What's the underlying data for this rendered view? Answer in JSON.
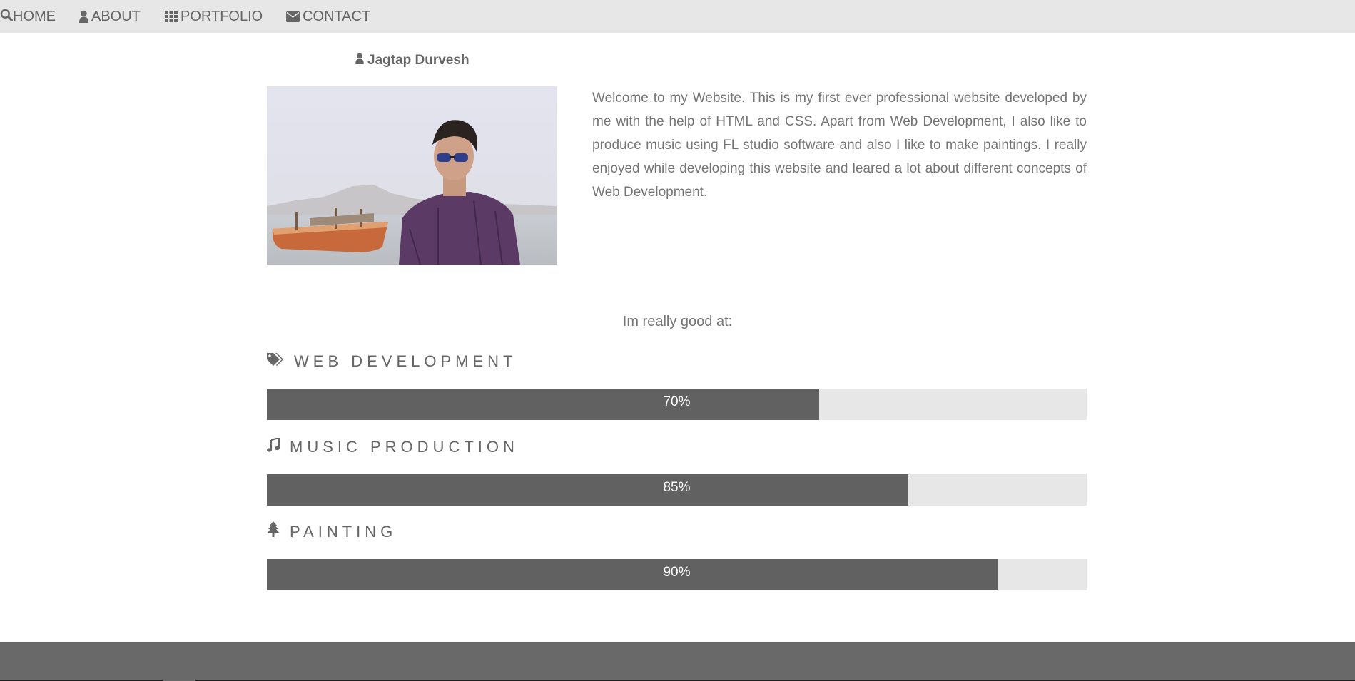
{
  "nav": {
    "home": "HOME",
    "about": "ABOUT",
    "portfolio": "PORTFOLIO",
    "contact": "CONTACT",
    "about_icon": "user-icon",
    "portfolio_icon": "grid-icon",
    "contact_icon": "envelope-icon",
    "search_icon": "search-icon"
  },
  "profile": {
    "name": "Jagtap Durvesh",
    "name_icon": "user-icon",
    "bio": "Welcome to my Website. This is my first ever professional website developed by me with the help of HTML and CSS. Apart from Web Development, I also like to produce music using FL studio software and also I like to make paintings. I really enjoyed while developing this website and leared a lot about different concepts of Web Development."
  },
  "skills_heading": "Im really good at:",
  "skills": [
    {
      "title": "WEB DEVELOPMENT",
      "icon": "tags-icon",
      "percent_label": "70%",
      "level": 0.674
    },
    {
      "title": "MUSIC PRODUCTION",
      "icon": "music-icon",
      "percent_label": "85%",
      "level": 0.782
    },
    {
      "title": "PAINTING",
      "icon": "tree-icon",
      "percent_label": "90%",
      "level": 0.891
    }
  ],
  "colors": {
    "navbar_bg": "#e7e7e7",
    "bar_fill": "#616161",
    "bar_track": "#e7e7e7",
    "footer_bg": "#696969",
    "text": "#666666"
  }
}
